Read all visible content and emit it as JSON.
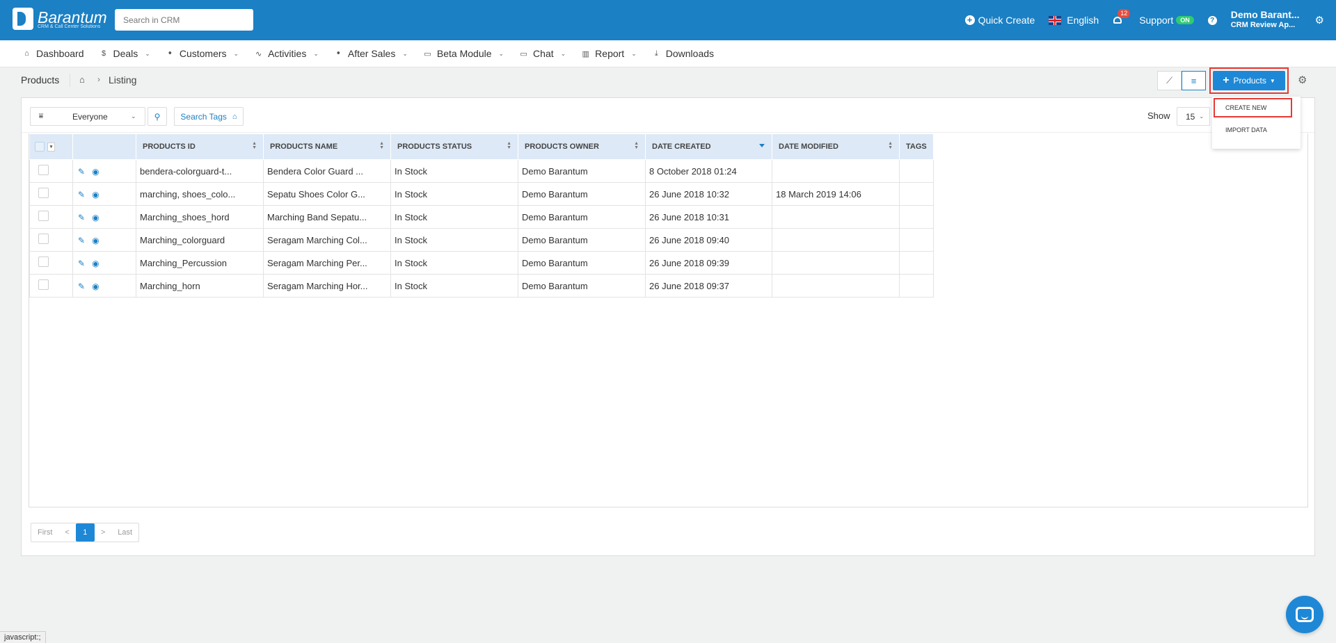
{
  "app": {
    "logo_name": "Barantum",
    "logo_sub": "CRM & Call Center Solutions"
  },
  "topbar": {
    "search_placeholder": "Search in CRM",
    "quick_create": "Quick Create",
    "language": "English",
    "notification_count": "12",
    "support": "Support",
    "support_status": "ON",
    "help": "?",
    "user_name": "Demo Barant...",
    "user_company": "CRM Review Ap..."
  },
  "nav": {
    "dashboard": "Dashboard",
    "deals": "Deals",
    "customers": "Customers",
    "activities": "Activities",
    "after_sales": "After Sales",
    "beta_module": "Beta Module",
    "chat": "Chat",
    "report": "Report",
    "downloads": "Downloads"
  },
  "breadcrumb": {
    "title": "Products",
    "separator": "›",
    "current": "Listing"
  },
  "actions": {
    "products_button": "Products",
    "dropdown": {
      "create_new": "CREATE NEW",
      "import_data": "IMPORT DATA"
    }
  },
  "toolbar": {
    "filter_value": "Everyone",
    "search_tags": "Search Tags",
    "show_label": "Show",
    "show_value": "15"
  },
  "table": {
    "columns": [
      "PRODUCTS ID",
      "PRODUCTS NAME",
      "PRODUCTS STATUS",
      "PRODUCTS OWNER",
      "DATE CREATED",
      "DATE MODIFIED",
      "TAGS"
    ],
    "rows": [
      {
        "id": "bendera-colorguard-t...",
        "name": "Bendera Color Guard ...",
        "status": "In Stock",
        "owner": "Demo Barantum",
        "created": "8 October 2018 01:24",
        "modified": "",
        "tags": ""
      },
      {
        "id": "marching, shoes_colo...",
        "name": "Sepatu Shoes Color G...",
        "status": "In Stock",
        "owner": "Demo Barantum",
        "created": "26 June 2018 10:32",
        "modified": "18 March 2019 14:06",
        "tags": ""
      },
      {
        "id": "Marching_shoes_hord",
        "name": "Marching Band Sepatu...",
        "status": "In Stock",
        "owner": "Demo Barantum",
        "created": "26 June 2018 10:31",
        "modified": "",
        "tags": ""
      },
      {
        "id": "Marching_colorguard",
        "name": "Seragam Marching Col...",
        "status": "In Stock",
        "owner": "Demo Barantum",
        "created": "26 June 2018 09:40",
        "modified": "",
        "tags": ""
      },
      {
        "id": "Marching_Percussion",
        "name": "Seragam Marching Per...",
        "status": "In Stock",
        "owner": "Demo Barantum",
        "created": "26 June 2018 09:39",
        "modified": "",
        "tags": ""
      },
      {
        "id": "Marching_horn",
        "name": "Seragam Marching Hor...",
        "status": "In Stock",
        "owner": "Demo Barantum",
        "created": "26 June 2018 09:37",
        "modified": "",
        "tags": ""
      }
    ]
  },
  "pager": {
    "first": "First",
    "prev": "<",
    "current": "1",
    "next": ">",
    "last": "Last"
  },
  "status_bar": "javascript:;",
  "colors": {
    "brand": "#1b80c4",
    "accent_button": "#1e88d6",
    "header_row": "#dde9f7",
    "highlight": "#e53935"
  },
  "icons": [
    "home-icon",
    "dollar-icon",
    "users-icon",
    "activity-icon",
    "folder-icon",
    "chat-icon",
    "chart-icon",
    "download-icon",
    "plus-circle-icon",
    "bell-icon",
    "help-icon",
    "gear-icon",
    "line-chart-icon",
    "list-icon",
    "filter-icon",
    "search-icon",
    "tag-icon",
    "pencil-icon",
    "eye-icon",
    "messenger-icon"
  ]
}
